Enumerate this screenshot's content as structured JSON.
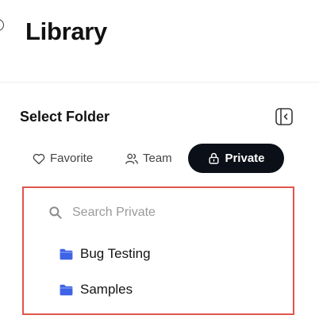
{
  "header": {
    "title": "Library"
  },
  "folder_selector": {
    "title": "Select Folder",
    "tabs": [
      {
        "label": "Favorite",
        "icon": "heart-icon",
        "active": false
      },
      {
        "label": "Team",
        "icon": "users-icon",
        "active": false
      },
      {
        "label": "Private",
        "icon": "lock-icon",
        "active": true
      }
    ],
    "search": {
      "placeholder": "Search Private",
      "value": ""
    },
    "folders": [
      {
        "label": "Bug Testing",
        "icon": "folder-icon"
      },
      {
        "label": "Samples",
        "icon": "folder-icon"
      }
    ]
  },
  "colors": {
    "active_tab_bg": "#0b0f17",
    "folder_icon": "#3f63e6",
    "highlight_border": "#e0554a"
  }
}
